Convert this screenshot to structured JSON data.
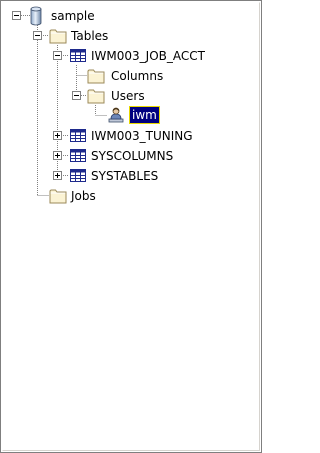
{
  "tree": {
    "root": {
      "label": "sample",
      "icon": "database-icon",
      "expanded": true
    },
    "tables": {
      "label": "Tables",
      "icon": "folder-icon",
      "expanded": true
    },
    "iwm003_job_acct": {
      "label": "IWM003_JOB_ACCT",
      "icon": "table-icon",
      "expanded": true
    },
    "columns": {
      "label": "Columns",
      "icon": "folder-icon"
    },
    "users": {
      "label": "Users",
      "icon": "folder-icon",
      "expanded": true
    },
    "user_iwm": {
      "label": "iwm",
      "icon": "user-icon",
      "selected": true
    },
    "iwm003_tuning": {
      "label": "IWM003_TUNING",
      "icon": "table-icon",
      "expanded": false
    },
    "syscolumns": {
      "label": "SYSCOLUMNS",
      "icon": "table-icon",
      "expanded": false
    },
    "systables": {
      "label": "SYSTABLES",
      "icon": "table-icon",
      "expanded": false
    },
    "jobs": {
      "label": "Jobs",
      "icon": "folder-icon"
    }
  },
  "colors": {
    "tree_line": "#808080",
    "folder_fill": "#fbf3d4",
    "folder_stroke": "#9b8a5a",
    "table_fill": "#1e2a8c",
    "selection_bg": "#000080",
    "selection_outline": "#e8d800"
  }
}
